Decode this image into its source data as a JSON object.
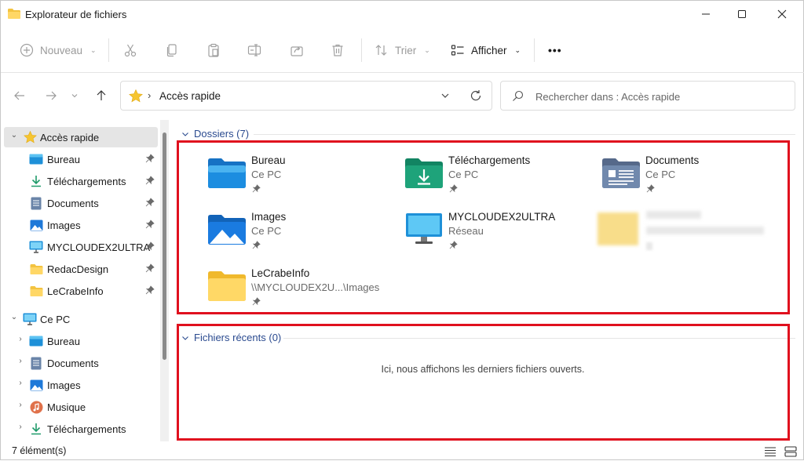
{
  "window": {
    "title": "Explorateur de fichiers",
    "minimize_icon": "minimize-icon",
    "maximize_icon": "maximize-icon",
    "close_icon": "close-icon"
  },
  "commandbar": {
    "new_label": "Nouveau",
    "sort_label": "Trier",
    "view_label": "Afficher",
    "more_label": "•••",
    "icons": [
      "plus-circle-icon",
      "cut-icon",
      "copy-icon",
      "paste-icon",
      "rename-icon",
      "share-icon",
      "delete-icon",
      "sort-icon",
      "view-icon"
    ]
  },
  "address": {
    "breadcrumb": "Accès rapide",
    "search_placeholder": "Rechercher dans : Accès rapide"
  },
  "sidebar": {
    "quick_access": {
      "label": "Accès rapide",
      "items": [
        {
          "label": "Bureau",
          "icon": "desktop-icon"
        },
        {
          "label": "Téléchargements",
          "icon": "download-icon"
        },
        {
          "label": "Documents",
          "icon": "document-icon"
        },
        {
          "label": "Images",
          "icon": "images-icon"
        },
        {
          "label": "MYCLOUDEX2ULTRA",
          "icon": "network-drive-icon"
        },
        {
          "label": "RedacDesign",
          "icon": "folder-icon"
        },
        {
          "label": "LeCrabeInfo",
          "icon": "folder-icon"
        }
      ]
    },
    "this_pc": {
      "label": "Ce PC",
      "items": [
        {
          "label": "Bureau",
          "icon": "desktop-icon"
        },
        {
          "label": "Documents",
          "icon": "document-icon"
        },
        {
          "label": "Images",
          "icon": "images-icon"
        },
        {
          "label": "Musique",
          "icon": "music-icon"
        },
        {
          "label": "Téléchargements",
          "icon": "download-icon"
        }
      ]
    }
  },
  "content": {
    "folders_header": "Dossiers (7)",
    "folders": [
      {
        "name": "Bureau",
        "sub": "Ce PC",
        "icon": "desktop-folder-icon"
      },
      {
        "name": "Téléchargements",
        "sub": "Ce PC",
        "icon": "downloads-folder-icon"
      },
      {
        "name": "Documents",
        "sub": "Ce PC",
        "icon": "documents-folder-icon"
      },
      {
        "name": "Images",
        "sub": "Ce PC",
        "icon": "images-folder-icon"
      },
      {
        "name": "MYCLOUDEX2ULTRA",
        "sub": "Réseau",
        "icon": "network-monitor-icon"
      },
      {
        "name": "LeCrabeInfo",
        "sub": "\\\\MYCLOUDEX2U...\\Images",
        "icon": "folder-icon"
      }
    ],
    "recent_header": "Fichiers récents (0)",
    "recent_empty": "Ici, nous affichons les derniers fichiers ouverts."
  },
  "status": {
    "count": "7 élément(s)"
  },
  "colors": {
    "highlight": "#e0101e",
    "section_header": "#2a4a8f",
    "selected_nav": "#e5e5e5"
  }
}
